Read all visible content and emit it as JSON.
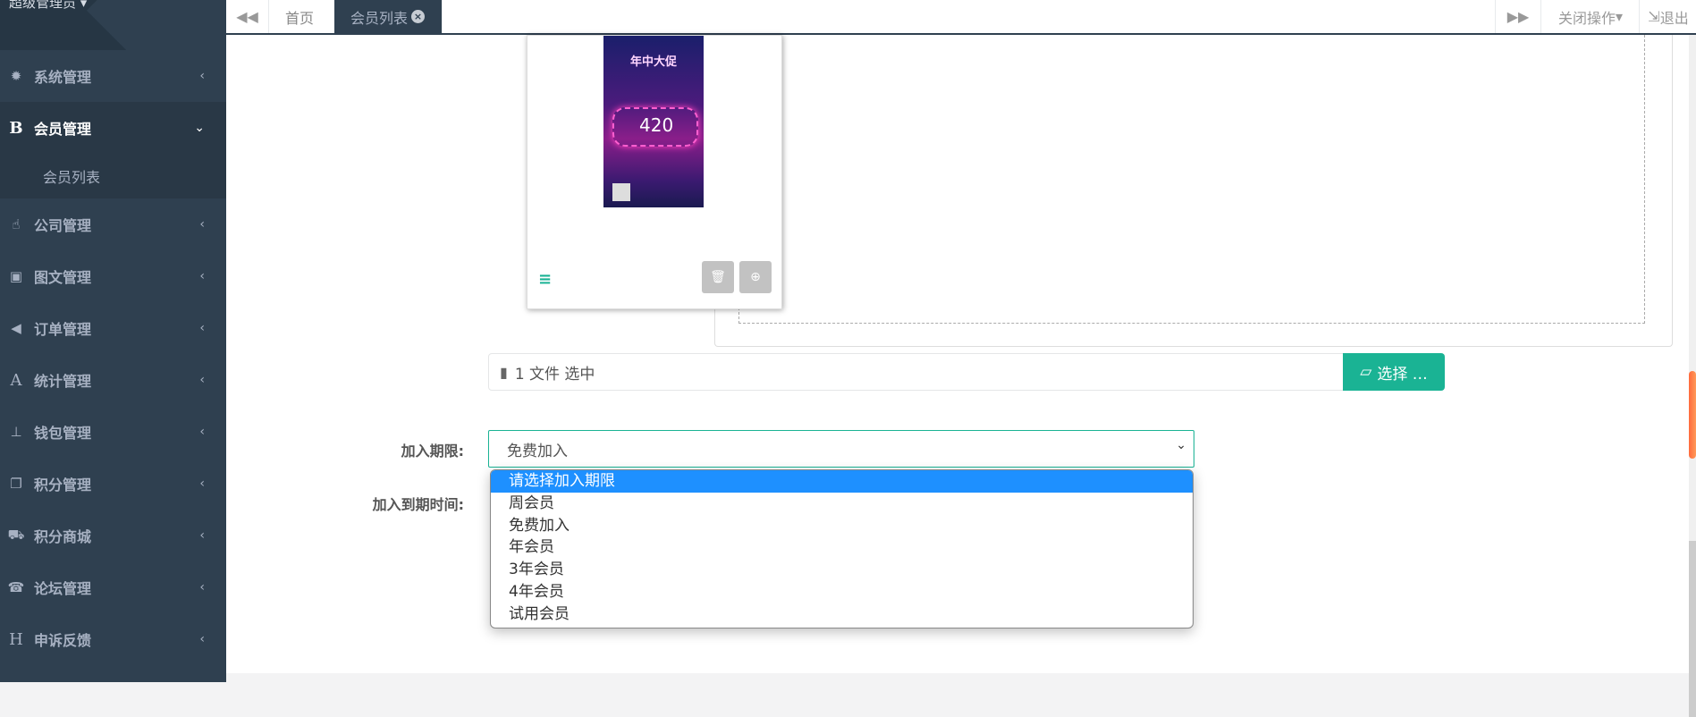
{
  "sidebar": {
    "user_name": "超级管理员",
    "items": [
      {
        "icon": "gear-icon",
        "glyph": "✹",
        "label": "系统管理"
      },
      {
        "icon": "bold-b-icon",
        "glyph": "B",
        "label": "会员管理",
        "expanded": true
      },
      {
        "icon": "hand-icon",
        "glyph": "☝",
        "label": "公司管理"
      },
      {
        "icon": "image-icon",
        "glyph": "▣",
        "label": "图文管理"
      },
      {
        "icon": "megaphone-icon",
        "glyph": "◀",
        "label": "订单管理"
      },
      {
        "icon": "font-a-icon",
        "glyph": "A",
        "label": "统计管理"
      },
      {
        "icon": "stamp-icon",
        "glyph": "⊥",
        "label": "钱包管理"
      },
      {
        "icon": "copy-icon",
        "glyph": "❐",
        "label": "积分管理"
      },
      {
        "icon": "cart-icon",
        "glyph": "⛟",
        "label": "积分商城"
      },
      {
        "icon": "phone-icon",
        "glyph": "☎",
        "label": "论坛管理"
      },
      {
        "icon": "header-h-icon",
        "glyph": "H",
        "label": "申诉反馈"
      }
    ],
    "sub_items": [
      {
        "label": "会员列表"
      }
    ]
  },
  "topbar": {
    "tabs": [
      {
        "label": "首页"
      },
      {
        "label": "会员列表",
        "active": true
      }
    ],
    "close_ops": "关闭操作",
    "logout": "退出"
  },
  "upload": {
    "poster_title": "年中大促",
    "poster_number": "420",
    "file_caption": "1 文件 选中",
    "choose_label": "选择 …"
  },
  "form": {
    "join_period_label": "加入期限:",
    "join_period_value": "免费加入",
    "expire_label": "加入到期时间:",
    "options": [
      "请选择加入期限",
      "周会员",
      "免费加入",
      "年会员",
      "3年会员",
      "4年会员",
      "试用会员"
    ],
    "highlighted_option": "请选择加入期限"
  },
  "colors": {
    "sidebar_bg": "#2f4050",
    "accent": "#1ab394",
    "option_highlight": "#1e90ff"
  }
}
